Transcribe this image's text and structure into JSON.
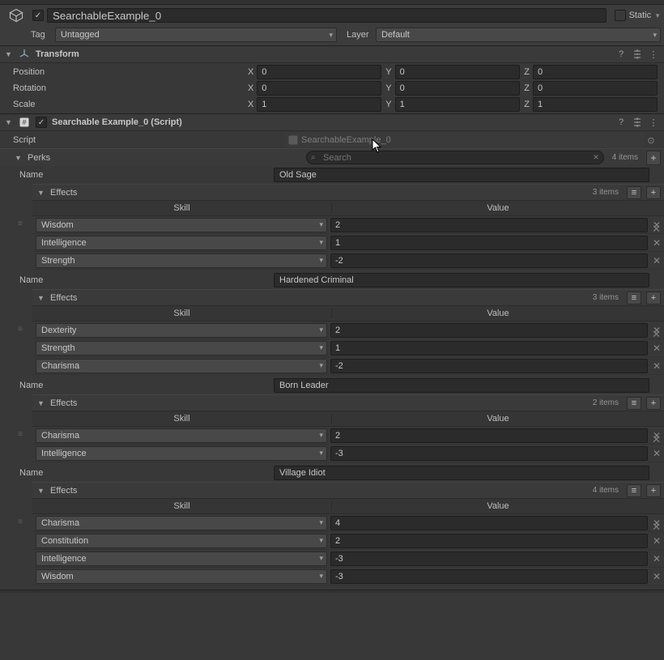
{
  "header": {
    "name": "SearchableExample_0",
    "checked": true,
    "static_label": "Static",
    "tag_label": "Tag",
    "tag_value": "Untagged",
    "layer_label": "Layer",
    "layer_value": "Default"
  },
  "transform": {
    "title": "Transform",
    "position_label": "Position",
    "rotation_label": "Rotation",
    "scale_label": "Scale",
    "px": "0",
    "py": "0",
    "pz": "0",
    "rx": "0",
    "ry": "0",
    "rz": "0",
    "sx": "1",
    "sy": "1",
    "sz": "1"
  },
  "script_component": {
    "title": "Searchable Example_0 (Script)",
    "script_label": "Script",
    "script_value": "SearchableExample_0"
  },
  "perks_header": {
    "label": "Perks",
    "search_placeholder": "Search",
    "count": "4 items"
  },
  "col_headers": {
    "skill": "Skill",
    "value": "Value"
  },
  "labels": {
    "name": "Name",
    "effects": "Effects"
  },
  "perks": [
    {
      "name": "Old Sage",
      "effects_count": "3 items",
      "effects": [
        {
          "skill": "Wisdom",
          "value": "2"
        },
        {
          "skill": "Intelligence",
          "value": "1"
        },
        {
          "skill": "Strength",
          "value": "-2"
        }
      ]
    },
    {
      "name": "Hardened Criminal",
      "effects_count": "3 items",
      "effects": [
        {
          "skill": "Dexterity",
          "value": "2"
        },
        {
          "skill": "Strength",
          "value": "1"
        },
        {
          "skill": "Charisma",
          "value": "-2"
        }
      ]
    },
    {
      "name": "Born Leader",
      "effects_count": "2 items",
      "effects": [
        {
          "skill": "Charisma",
          "value": "2"
        },
        {
          "skill": "Intelligence",
          "value": "-3"
        }
      ]
    },
    {
      "name": "Village Idiot",
      "effects_count": "4 items",
      "effects": [
        {
          "skill": "Charisma",
          "value": "4"
        },
        {
          "skill": "Constitution",
          "value": "2"
        },
        {
          "skill": "Intelligence",
          "value": "-3"
        },
        {
          "skill": "Wisdom",
          "value": "-3"
        }
      ]
    }
  ]
}
